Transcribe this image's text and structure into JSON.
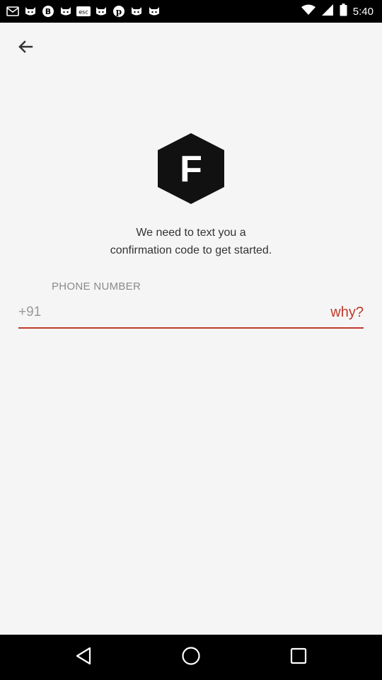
{
  "status_bar": {
    "time": "5:40",
    "left_icons": [
      "mail-icon",
      "cat-icon",
      "bitcoin-icon",
      "cat-icon",
      "esc-icon",
      "cat-icon",
      "pinterest-icon",
      "cat-icon",
      "cat-icon"
    ],
    "right_icons": [
      "wifi-icon",
      "signal-icon",
      "battery-icon"
    ]
  },
  "header": {
    "back_icon": "arrow-left-icon"
  },
  "logo": {
    "letter": "F"
  },
  "message": {
    "line1": "We need to text you a",
    "line2": "confirmation code to get started."
  },
  "phone": {
    "label": "PHONE NUMBER",
    "country_code": "+91",
    "value": "",
    "placeholder": "",
    "why_label": "why?"
  },
  "colors": {
    "accent": "#c0392b",
    "background": "#f5f5f5",
    "label": "#8a8a8a",
    "text": "#333333"
  },
  "nav_bar": {
    "icons": [
      "back-triangle-icon",
      "home-circle-icon",
      "recents-square-icon"
    ]
  }
}
